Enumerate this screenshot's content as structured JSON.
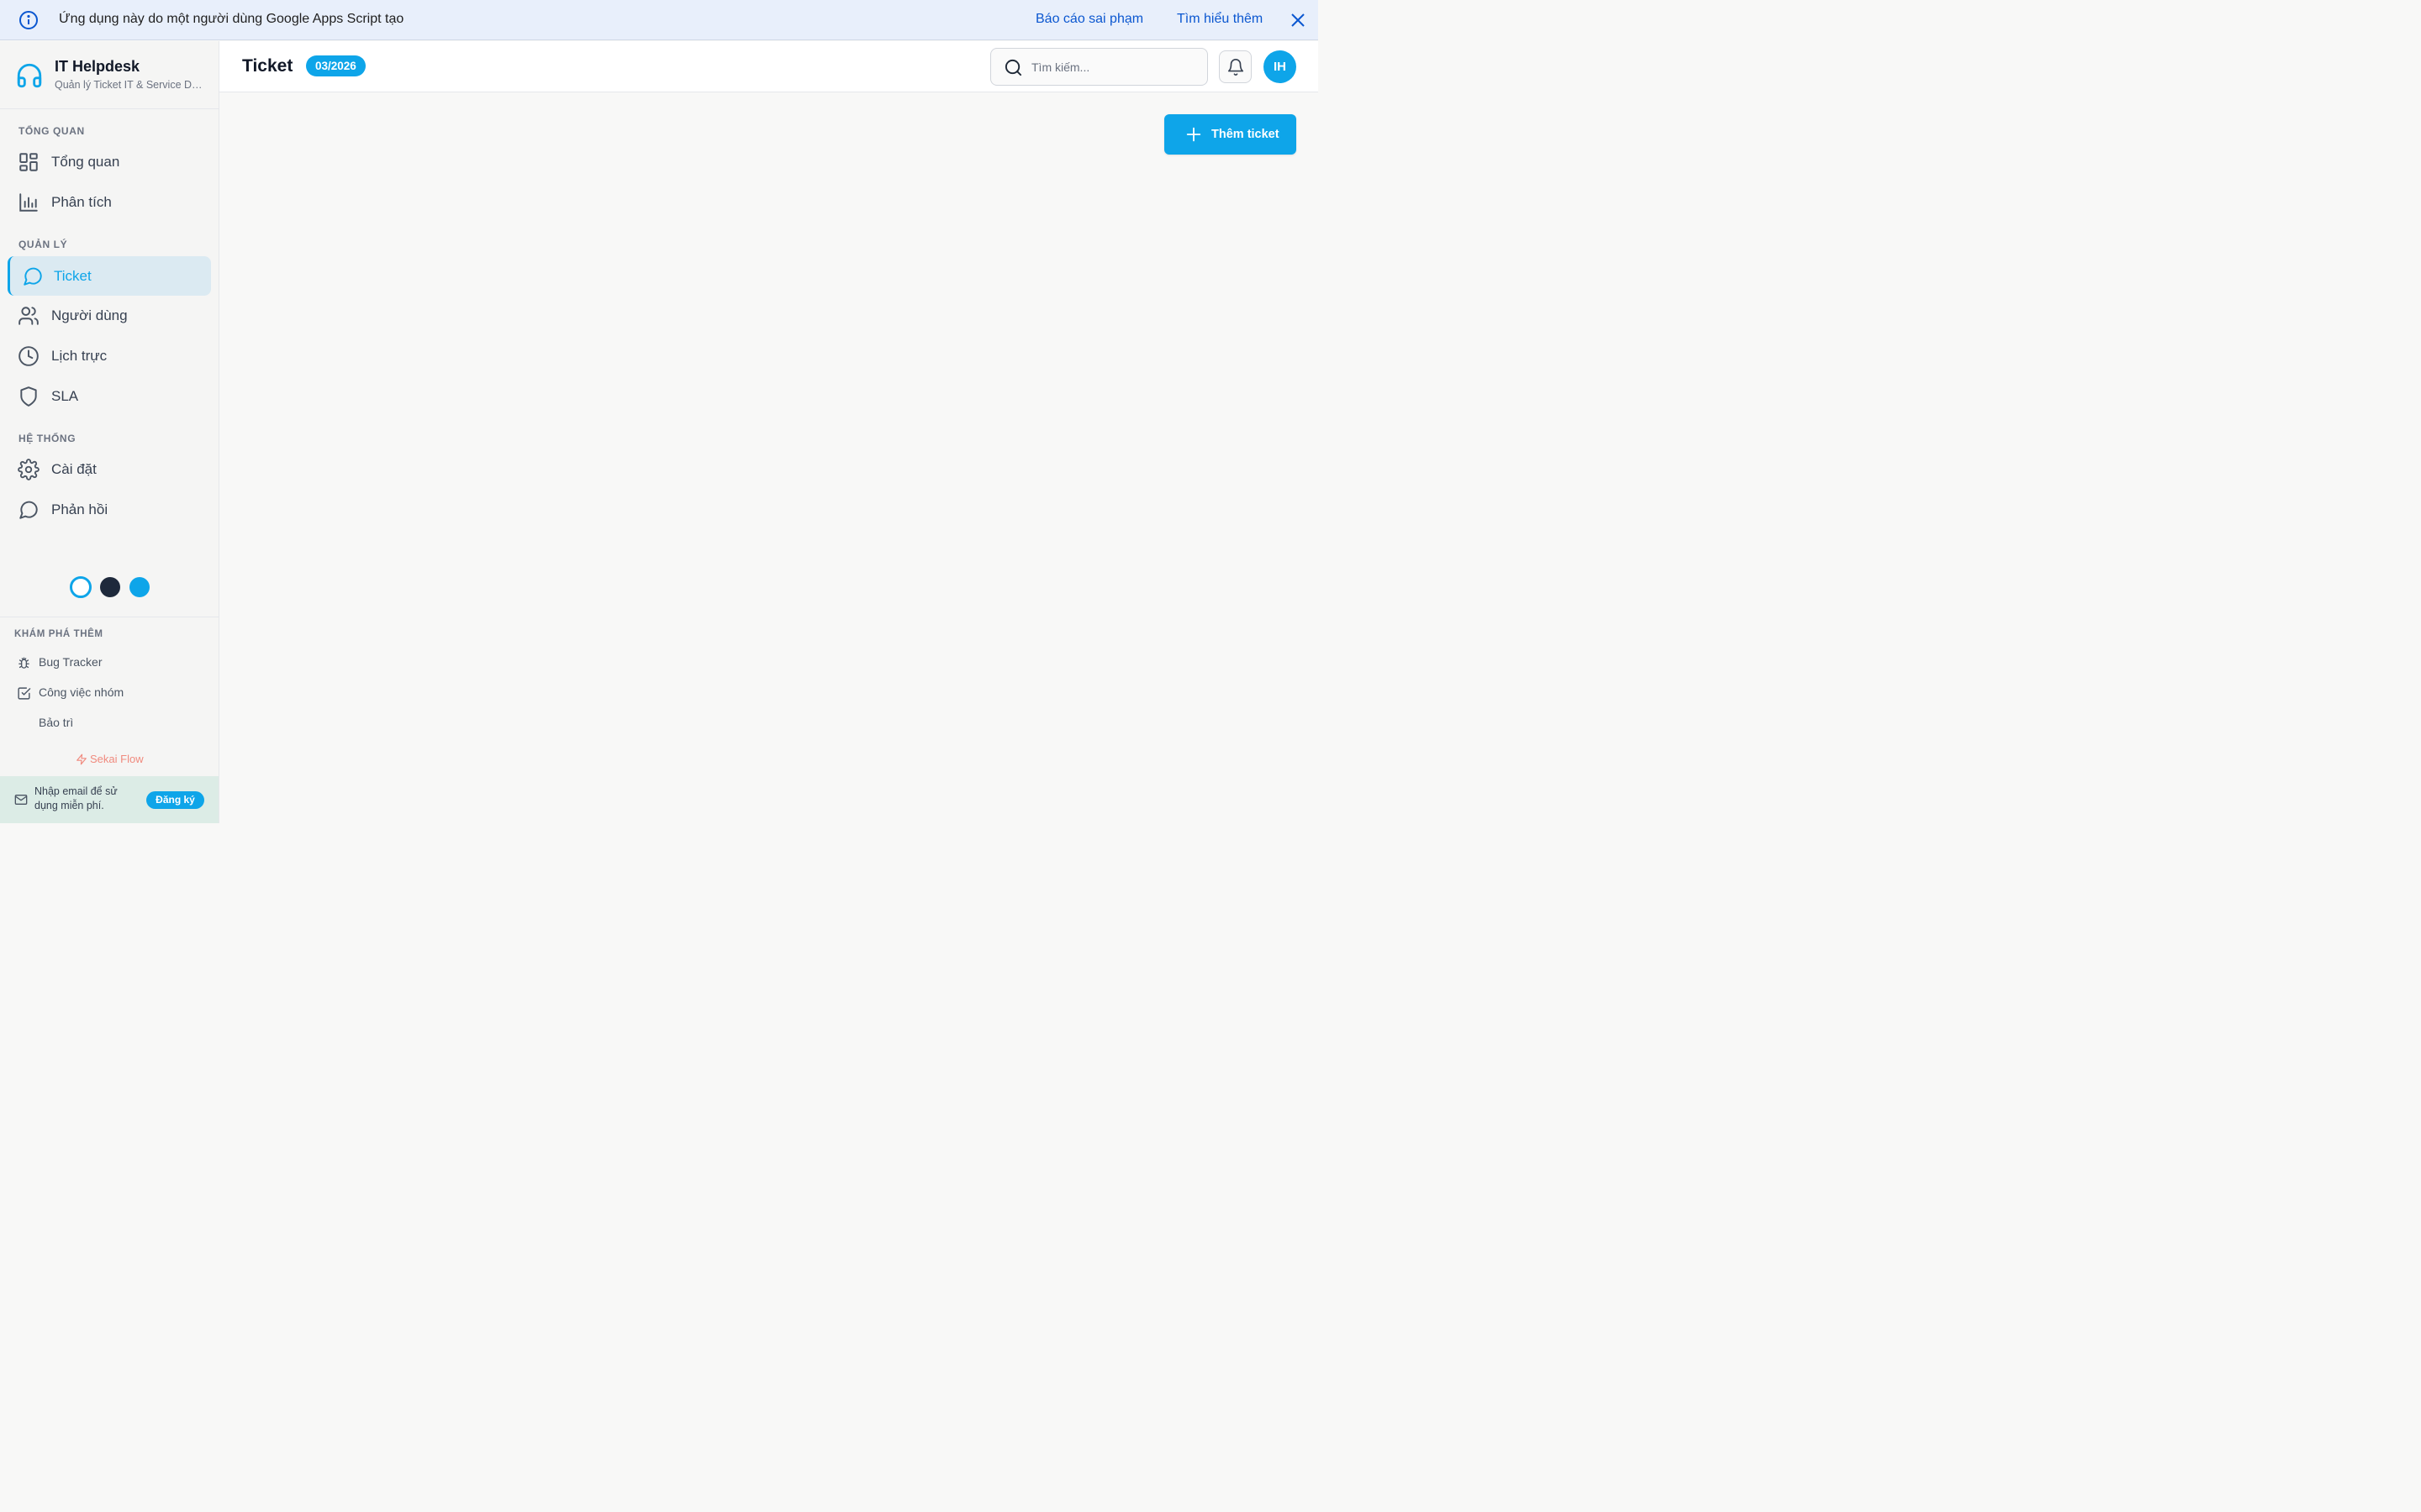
{
  "banner": {
    "message": "Ứng dụng này do một người dùng Google Apps Script tạo",
    "report_link": "Báo cáo sai phạm",
    "learn_link": "Tìm hiểu thêm"
  },
  "brand": {
    "name": "IT Helpdesk",
    "subtitle": "Quản lý Ticket IT & Service Desk"
  },
  "sidebar": {
    "sections": [
      {
        "title": "TỔNG QUAN",
        "items": [
          {
            "label": "Tổng quan",
            "icon": "dashboard-icon"
          },
          {
            "label": "Phân tích",
            "icon": "bar-chart-icon"
          }
        ]
      },
      {
        "title": "QUẢN LÝ",
        "items": [
          {
            "label": "Ticket",
            "icon": "message-circle-icon",
            "active": true
          },
          {
            "label": "Người dùng",
            "icon": "users-icon"
          },
          {
            "label": "Lịch trực",
            "icon": "clock-icon"
          },
          {
            "label": "SLA",
            "icon": "shield-icon"
          }
        ]
      },
      {
        "title": "HỆ THỐNG",
        "items": [
          {
            "label": "Cài đặt",
            "icon": "gear-icon"
          },
          {
            "label": "Phản hồi",
            "icon": "message-circle-icon"
          }
        ]
      }
    ],
    "themes": [
      {
        "name": "light",
        "color": "#ffffff",
        "selected": true
      },
      {
        "name": "dark",
        "color": "#1e293b"
      },
      {
        "name": "blue",
        "color": "#0ea5e9"
      }
    ],
    "explore": {
      "title": "KHÁM PHÁ THÊM",
      "items": [
        {
          "label": "Bug Tracker",
          "icon": "bug-icon"
        },
        {
          "label": "Công việc nhóm",
          "icon": "checkbox-icon"
        },
        {
          "label": "Bảo trì",
          "icon": ""
        }
      ]
    },
    "footer_brand": "Sekai Flow",
    "signup": {
      "text": "Nhập email để sử dụng miễn phí.",
      "button": "Đăng ký"
    }
  },
  "header": {
    "title": "Ticket",
    "period_badge": "03/2026",
    "search_placeholder": "Tìm kiếm...",
    "avatar_initials": "IH"
  },
  "main": {
    "add_button": "Thêm ticket"
  },
  "colors": {
    "accent": "#0ea5e9",
    "banner_bg": "#e8effb",
    "banner_link": "#0b57d0",
    "sidebar_bg": "#f5f5f4",
    "active_bg": "#dbeaf2",
    "content_bg": "#f8f8f7"
  }
}
